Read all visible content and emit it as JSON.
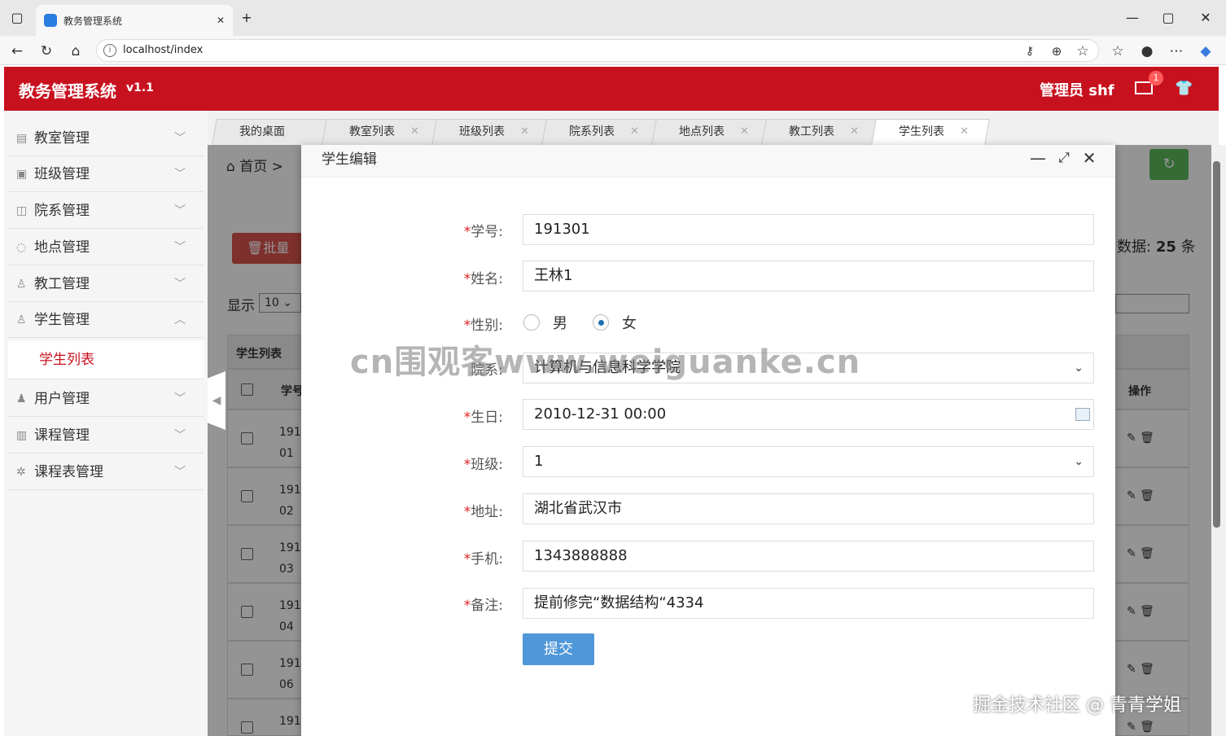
{
  "browser": {
    "tab_title": "教务管理系统",
    "url": "localhost/index"
  },
  "app": {
    "title": "教务管理系统",
    "version": "v1.1",
    "admin_label": "管理员  shf",
    "mail_badge": "1"
  },
  "sidebar": {
    "items": [
      {
        "label": "教室管理",
        "icon": "classroom-icon"
      },
      {
        "label": "班级管理",
        "icon": "image-icon"
      },
      {
        "label": "院系管理",
        "icon": "bag-icon"
      },
      {
        "label": "地点管理",
        "icon": "chat-icon"
      },
      {
        "label": "教工管理",
        "icon": "user-icon"
      },
      {
        "label": "学生管理",
        "icon": "user-icon"
      },
      {
        "label": "用户管理",
        "icon": "user-solid-icon"
      },
      {
        "label": "课程管理",
        "icon": "truck-icon"
      },
      {
        "label": "课程表管理",
        "icon": "gear-icon"
      }
    ],
    "sub_item": "学生列表"
  },
  "tabs": [
    "我的桌面",
    "教室列表",
    "班级列表",
    "院系列表",
    "地点列表",
    "教工列表",
    "学生列表"
  ],
  "background_page": {
    "breadcrumb_home": "首页",
    "breadcrumb_sep": ">",
    "batch_delete": "批量删",
    "count_prefix": "数据:",
    "count_value": "25",
    "count_suffix": "条",
    "show_label": "显示",
    "show_value": "10",
    "table_title": "学生列表",
    "col_id": "学号",
    "col_ops": "操作",
    "rows": [
      {
        "a": "191",
        "b": "01"
      },
      {
        "a": "191",
        "b": "02"
      },
      {
        "a": "191",
        "b": "03"
      },
      {
        "a": "191",
        "b": "04"
      },
      {
        "a": "191",
        "b": "06"
      },
      {
        "a": "191",
        "b": ""
      }
    ]
  },
  "modal": {
    "title": "学生编辑",
    "fields": {
      "student_id": {
        "label": "学号:",
        "value": "191301"
      },
      "name": {
        "label": "姓名:",
        "value": "王林1"
      },
      "gender": {
        "label": "性别:",
        "option_male": "男",
        "option_female": "女",
        "selected": "女"
      },
      "department": {
        "label": "院系:",
        "value": "计算机与信息科学学院"
      },
      "birthday": {
        "label": "生日:",
        "value": "2010-12-31 00:00"
      },
      "class": {
        "label": "班级:",
        "value": "1"
      },
      "address": {
        "label": "地址:",
        "value": "湖北省武汉市"
      },
      "phone": {
        "label": "手机:",
        "value": "1343888888"
      },
      "remark": {
        "label": "备注:",
        "value": "提前修完“数据结构“4334"
      }
    },
    "submit_label": "提交"
  },
  "watermark": "cn围观客www.weiguanke.cn",
  "credit": "掘金技术社区 @ 青青学姐",
  "colors": {
    "brand": "#c8111f",
    "submit": "#4f97d9",
    "refresh": "#5cb85c",
    "danger": "#d9534f"
  }
}
